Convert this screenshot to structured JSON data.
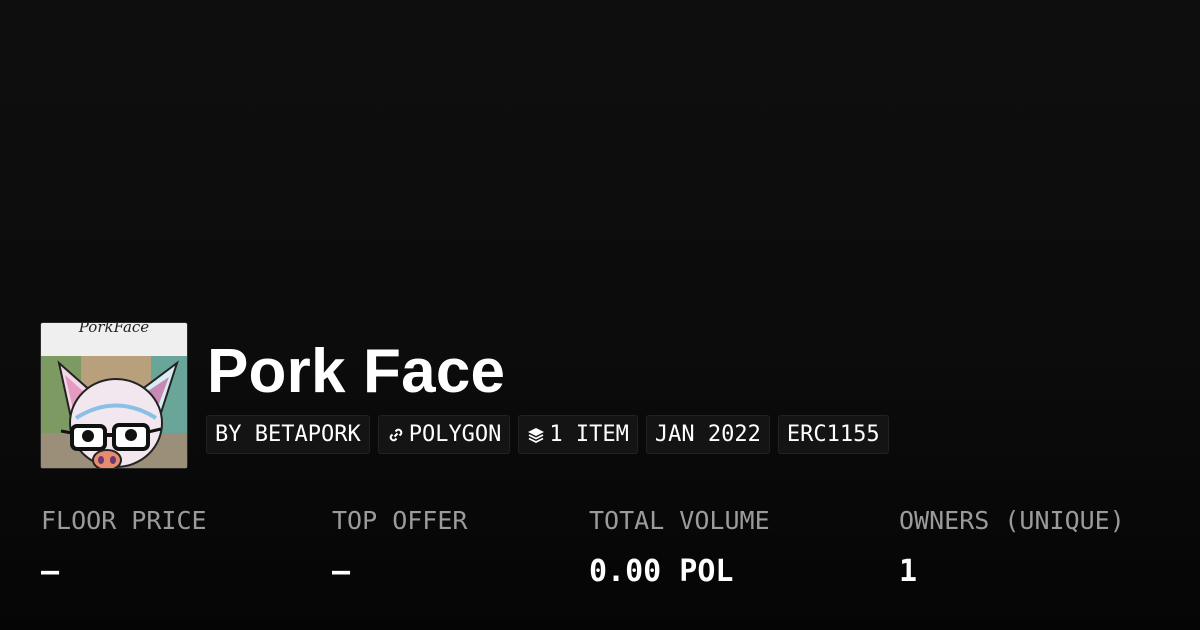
{
  "collection": {
    "title": "Pork Face",
    "avatar_caption": "PorkFace"
  },
  "tags": [
    {
      "label": "BY BETAPORK",
      "icon": null
    },
    {
      "label": "POLYGON",
      "icon": "link-icon"
    },
    {
      "label": "1 ITEM",
      "icon": "layers-icon"
    },
    {
      "label": "JAN 2022",
      "icon": null
    },
    {
      "label": "ERC1155",
      "icon": null
    }
  ],
  "stats": [
    {
      "label": "FLOOR PRICE",
      "value": "–"
    },
    {
      "label": "TOP OFFER",
      "value": "–"
    },
    {
      "label": "TOTAL VOLUME",
      "value": "0.00 POL"
    },
    {
      "label": "OWNERS (UNIQUE)",
      "value": "1"
    }
  ],
  "colors": {
    "background": "#0b0b0b",
    "tag_background": "#141414",
    "label_gray": "#9b9b9b",
    "text": "#ffffff"
  }
}
